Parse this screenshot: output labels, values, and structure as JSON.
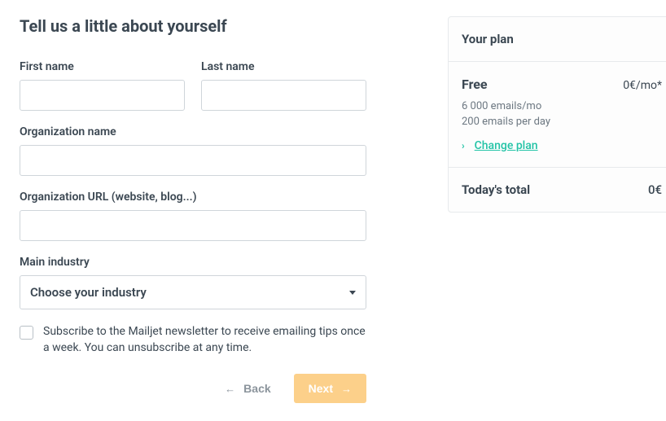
{
  "form": {
    "heading": "Tell us a little about yourself",
    "first_name": {
      "label": "First name",
      "value": ""
    },
    "last_name": {
      "label": "Last name",
      "value": ""
    },
    "org_name": {
      "label": "Organization name",
      "value": ""
    },
    "org_url": {
      "label": "Organization URL (website, blog...)",
      "value": ""
    },
    "industry": {
      "label": "Main industry",
      "placeholder": "Choose your industry",
      "selected": "Choose your industry"
    },
    "newsletter": {
      "checked": false,
      "text": "Subscribe to the Mailjet newsletter to receive emailing tips once a week. You can unsubscribe at any time."
    },
    "buttons": {
      "back": "Back",
      "next": "Next"
    }
  },
  "plan": {
    "header": "Your plan",
    "name": "Free",
    "price": "0€/mo*",
    "line1": "6 000 emails/mo",
    "line2": "200 emails per day",
    "change_link": "Change plan",
    "total_label": "Today's total",
    "total_value": "0€"
  }
}
